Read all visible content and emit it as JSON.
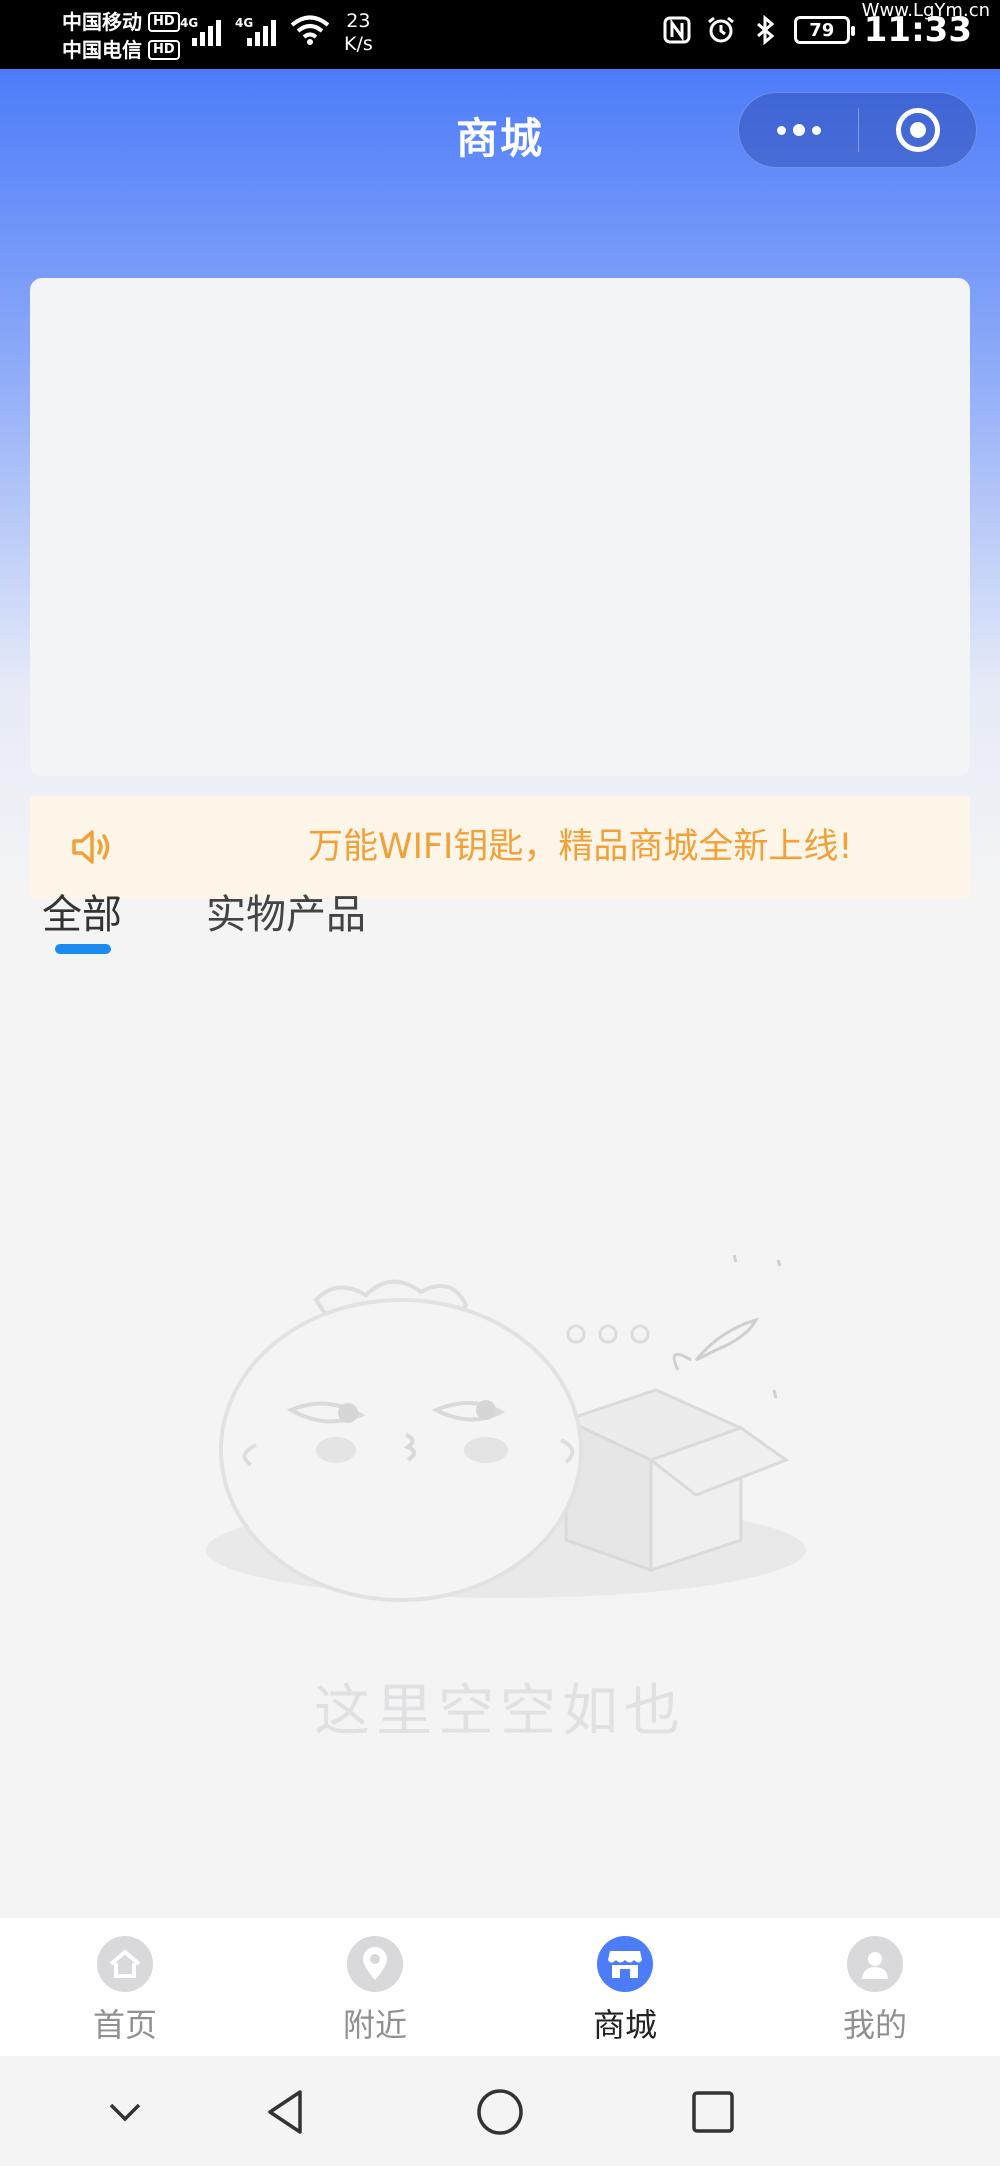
{
  "status_bar": {
    "carrier_1": "中国移动",
    "carrier_2": "中国电信",
    "hd_badge": "HD",
    "network_type": "4G",
    "net_speed_value": "23",
    "net_speed_unit": "K/s",
    "battery": "79",
    "time": "11:33",
    "watermark": "Www.LgYm.cn"
  },
  "header": {
    "title": "商城"
  },
  "notice": {
    "text": "万能WIFI钥匙，精品商城全新上线!"
  },
  "tabs": [
    {
      "label": "全部",
      "active": true
    },
    {
      "label": "实物产品",
      "active": false
    }
  ],
  "empty_state": {
    "text": "这里空空如也"
  },
  "tabbar": [
    {
      "label": "首页",
      "icon": "home-icon",
      "active": false
    },
    {
      "label": "附近",
      "icon": "location-icon",
      "active": false
    },
    {
      "label": "商城",
      "icon": "store-icon",
      "active": true
    },
    {
      "label": "我的",
      "icon": "user-icon",
      "active": false
    }
  ],
  "colors": {
    "primary": "#4d7cf9",
    "notice_text": "#f1a13a",
    "notice_bg": "#fdf5e8",
    "tab_indicator": "#1a8bf0"
  }
}
